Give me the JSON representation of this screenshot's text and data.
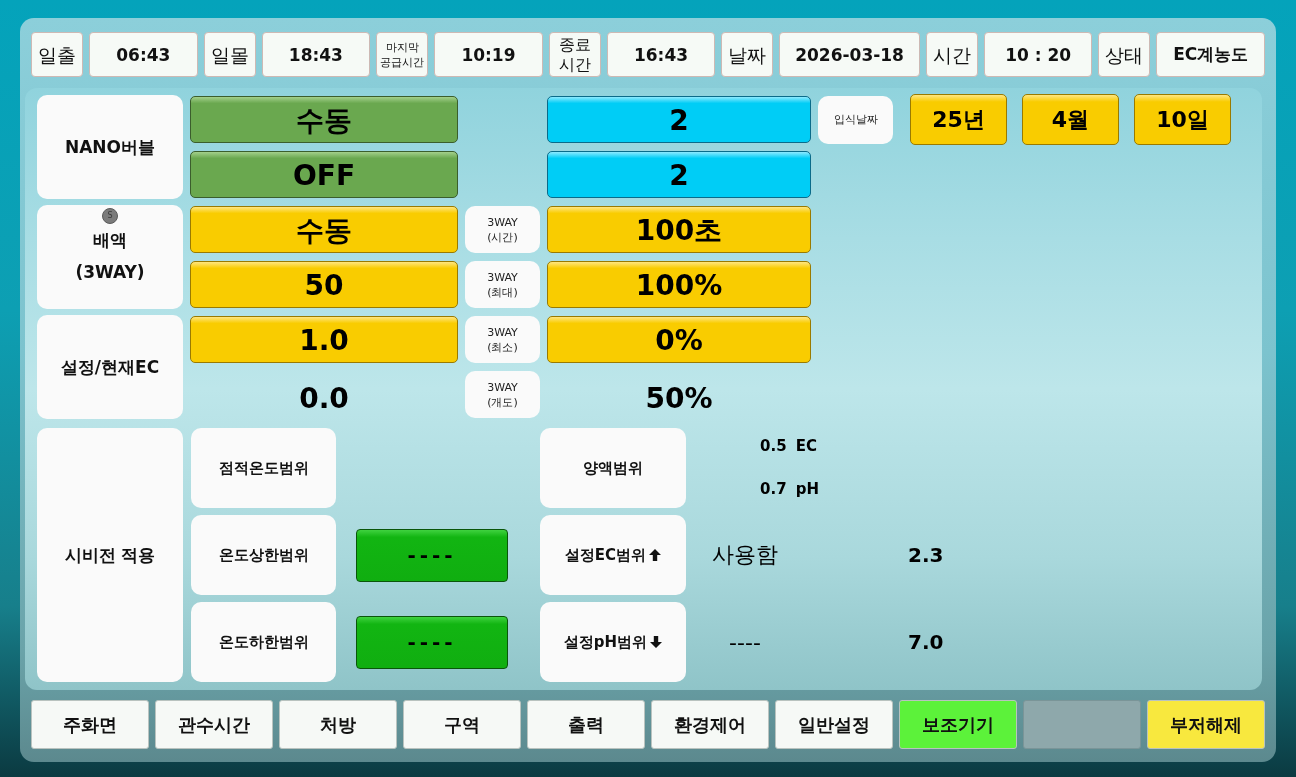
{
  "header": [
    {
      "label": "일출",
      "value": "06:43"
    },
    {
      "label": "일몰",
      "value": "18:43"
    },
    {
      "label": "마지막\n공급시간",
      "value": "10:19"
    },
    {
      "label": "종료\n시간",
      "value": "16:43"
    },
    {
      "label": "날짜",
      "value": "2026-03-18"
    },
    {
      "label": "시간",
      "value": "10 : 20"
    },
    {
      "label": "상태",
      "value": "EC계농도"
    }
  ],
  "controls": [
    {
      "label": "NANO버블",
      "rows": [
        {
          "left": {
            "kind": "switch",
            "text": "수동"
          },
          "right": {
            "kind": "count",
            "text": "2"
          }
        },
        {
          "left": {
            "kind": "switch",
            "text": "OFF"
          },
          "right": {
            "kind": "count",
            "text": "2"
          }
        }
      ]
    },
    {
      "label": "배액\n(3WAY)",
      "badge": "S",
      "rows": [
        {
          "left": {
            "kind": "setting",
            "text": "수동"
          },
          "tag": "3WAY\n(시간)",
          "right": {
            "kind": "setting",
            "text": "100초"
          }
        },
        {
          "left": {
            "kind": "setting",
            "text": "50"
          },
          "tag": "3WAY\n(최대)",
          "right": {
            "kind": "setting",
            "text": "100%"
          }
        }
      ]
    },
    {
      "label": "설정/현재EC",
      "rows": [
        {
          "left": {
            "kind": "setting",
            "text": "1.0"
          },
          "tag": "3WAY\n(최소)",
          "right": {
            "kind": "setting",
            "text": "0%"
          }
        },
        {
          "left": {
            "kind": "reading",
            "text": "0.0"
          },
          "tag": "3WAY\n(개도)",
          "right": {
            "kind": "reading",
            "text": "50%"
          }
        }
      ]
    }
  ],
  "planting_date": {
    "label": "입식날짜",
    "values": [
      "25년",
      "4월",
      "10일"
    ]
  },
  "fertigation": {
    "label": "시비전 적용",
    "temperature_ranges": [
      {
        "label": "점적온도범위"
      },
      {
        "label": "온도상한범위",
        "value": "----"
      },
      {
        "label": "온도하한범위",
        "value": "----"
      }
    ],
    "nutrient_ranges": [
      {
        "label": "양액범위",
        "kind": "plain",
        "readings": [
          "0.5 EC",
          "0.7 pH"
        ]
      },
      {
        "label": "설정EC범위",
        "kind": "up",
        "status": "사용함",
        "value": "2.3"
      },
      {
        "label": "설정pH범위",
        "kind": "down",
        "status": "----",
        "value": "7.0"
      }
    ]
  },
  "nav": [
    {
      "label": "주화면",
      "kind": "page",
      "selected": false
    },
    {
      "label": "관수시간",
      "kind": "page",
      "selected": false
    },
    {
      "label": "처방",
      "kind": "page",
      "selected": false
    },
    {
      "label": "구역",
      "kind": "page",
      "selected": false
    },
    {
      "label": "출력",
      "kind": "page",
      "selected": false
    },
    {
      "label": "환경제어",
      "kind": "page",
      "selected": false
    },
    {
      "label": "일반설정",
      "kind": "page",
      "selected": false
    },
    {
      "label": "보조기기",
      "kind": "page",
      "selected": true
    },
    {
      "kind": "blank",
      "selected": false
    },
    {
      "label": "부저해제",
      "kind": "buzzer",
      "selected": false
    }
  ]
}
